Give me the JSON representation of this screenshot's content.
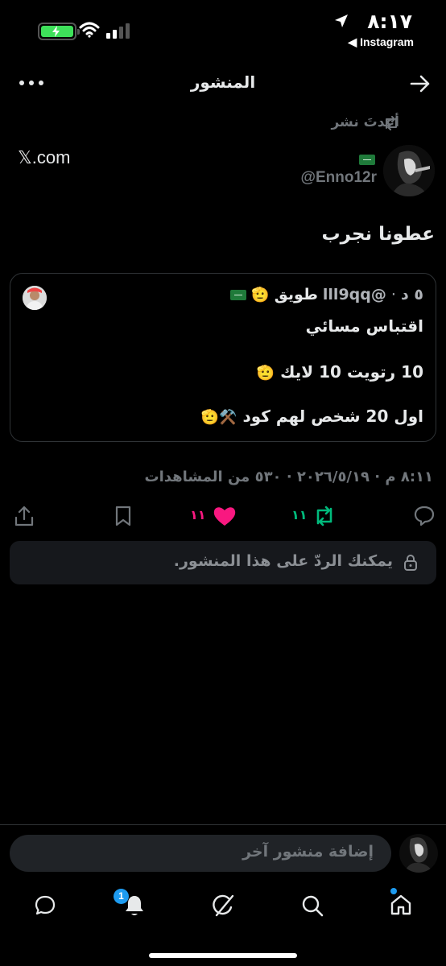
{
  "status_bar": {
    "time": "٨:١٧",
    "back_app": "◀ Instagram"
  },
  "header": {
    "title": "المنشور"
  },
  "post": {
    "reposted_label": "أعدتَ نشر",
    "handle": "@Enno12r",
    "link_text": "𝕏.com",
    "text": "عطونا نجرب",
    "quote": {
      "name": "طويق",
      "handle": "@lll9qq",
      "time": "٥ د",
      "lines": [
        "اقتباس مسائي",
        "10 رتويت 10 لايك",
        "اول 20 شخص لهم كود"
      ]
    },
    "meta": "٨:١١ م · ٢٠٢٦/٥/١٩ · ٥٣٠ من المشاهدات",
    "actions": {
      "likes_count": "١١",
      "reposts_count": "١١"
    },
    "reply_notice": "يمكنك الردّ على هذا المنشور."
  },
  "composer": {
    "placeholder": "إضافة منشور آخر"
  },
  "bottom_nav": {
    "notifications_badge": "1"
  },
  "colors": {
    "background": "#000000",
    "accent": "#1d9bf0",
    "like": "#f91880",
    "repost": "#00ba7c",
    "muted": "#71767b"
  }
}
